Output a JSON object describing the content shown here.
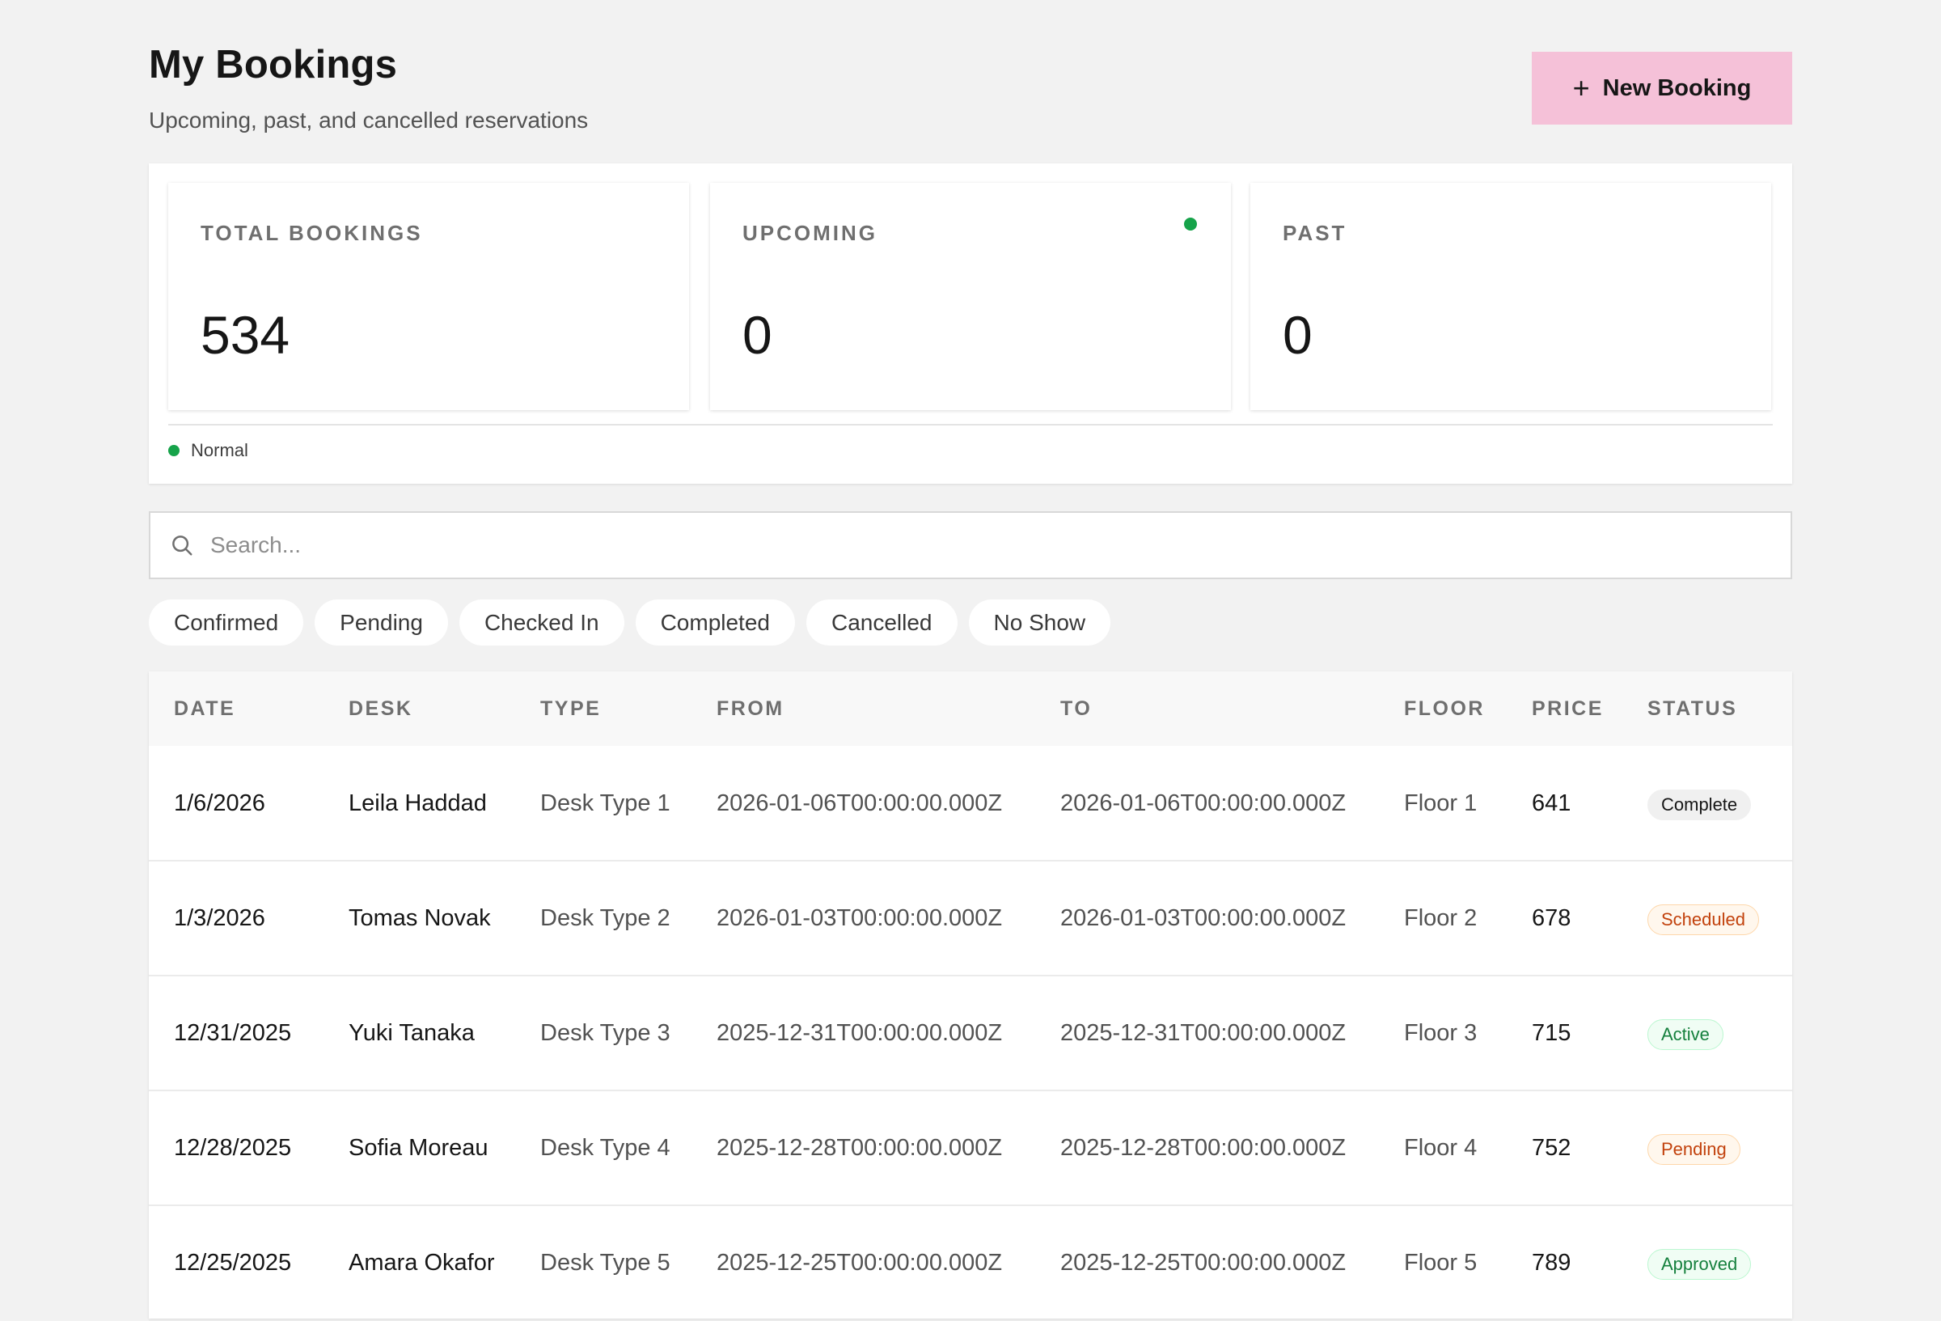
{
  "header": {
    "title": "My Bookings",
    "subtitle": "Upcoming, past, and cancelled reservations",
    "new_booking_label": "New Booking"
  },
  "stats": [
    {
      "label": "TOTAL BOOKINGS",
      "value": "534"
    },
    {
      "label": "UPCOMING",
      "value": "0"
    },
    {
      "label": "PAST",
      "value": "0"
    }
  ],
  "status_legend": {
    "label": "Normal",
    "color": "#16a34a"
  },
  "search": {
    "placeholder": "Search...",
    "value": ""
  },
  "filters": [
    "Confirmed",
    "Pending",
    "Checked In",
    "Completed",
    "Cancelled",
    "No Show"
  ],
  "table": {
    "columns": [
      "DATE",
      "DESK",
      "TYPE",
      "FROM",
      "TO",
      "FLOOR",
      "PRICE",
      "STATUS"
    ],
    "rows": [
      {
        "date": "1/6/2026",
        "desk": "Leila Haddad",
        "type": "Desk Type 1",
        "from": "2026-01-06T00:00:00.000Z",
        "to": "2026-01-06T00:00:00.000Z",
        "floor": "Floor 1",
        "price": "641",
        "status": "Complete",
        "status_tone": "gray"
      },
      {
        "date": "1/3/2026",
        "desk": "Tomas Novak",
        "type": "Desk Type 2",
        "from": "2026-01-03T00:00:00.000Z",
        "to": "2026-01-03T00:00:00.000Z",
        "floor": "Floor 2",
        "price": "678",
        "status": "Scheduled",
        "status_tone": "orange"
      },
      {
        "date": "12/31/2025",
        "desk": "Yuki Tanaka",
        "type": "Desk Type 3",
        "from": "2025-12-31T00:00:00.000Z",
        "to": "2025-12-31T00:00:00.000Z",
        "floor": "Floor 3",
        "price": "715",
        "status": "Active",
        "status_tone": "green"
      },
      {
        "date": "12/28/2025",
        "desk": "Sofia Moreau",
        "type": "Desk Type 4",
        "from": "2025-12-28T00:00:00.000Z",
        "to": "2025-12-28T00:00:00.000Z",
        "floor": "Floor 4",
        "price": "752",
        "status": "Pending",
        "status_tone": "orange"
      },
      {
        "date": "12/25/2025",
        "desk": "Amara Okafor",
        "type": "Desk Type 5",
        "from": "2025-12-25T00:00:00.000Z",
        "to": "2025-12-25T00:00:00.000Z",
        "floor": "Floor 5",
        "price": "789",
        "status": "Approved",
        "status_tone": "green"
      }
    ]
  },
  "colors": {
    "accent": "#f5c1d8",
    "success": "#16a34a"
  },
  "icons": {
    "new_booking": "plus-icon",
    "search": "search-icon",
    "upcoming": "status-dot-icon"
  }
}
